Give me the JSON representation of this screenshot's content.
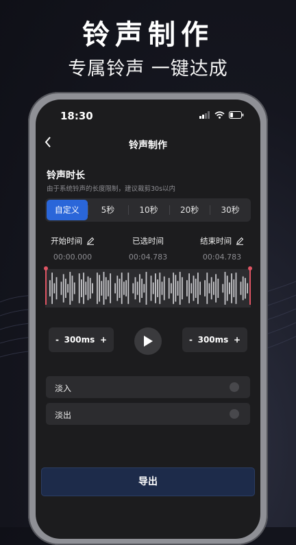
{
  "promo": {
    "title": "铃声制作",
    "subtitle": "专属铃声 一键达成"
  },
  "status_bar": {
    "time": "18:30",
    "icons": [
      "signal-icon",
      "wifi-icon",
      "battery-icon"
    ]
  },
  "nav": {
    "back_icon": "chevron-left-icon",
    "title": "铃声制作"
  },
  "ringtone_length": {
    "title": "铃声时长",
    "description": "由于系统铃声的长度限制，建议裁剪30s以内",
    "options": [
      "自定义",
      "5秒",
      "10秒",
      "20秒",
      "30秒"
    ],
    "selected": "自定义"
  },
  "times": {
    "start_label": "开始时间",
    "start_value": "00:00.000",
    "selected_label": "已选时间",
    "selected_value": "00:04.783",
    "end_label": "结束时间",
    "end_value": "00:04.783"
  },
  "controls": {
    "left_stepper": {
      "minus": "-",
      "value": "300ms",
      "plus": "+"
    },
    "right_stepper": {
      "minus": "-",
      "value": "300ms",
      "plus": "+"
    },
    "play_icon": "play-icon"
  },
  "fade": {
    "fade_in_label": "淡入",
    "fade_out_label": "淡出"
  },
  "export_label": "导出",
  "colors": {
    "accent": "#2a66d9",
    "marker": "#e05564",
    "export_bg": "#1d2b4a",
    "screen_bg": "#1c1c1e",
    "panel_bg": "#2c2c2f"
  }
}
